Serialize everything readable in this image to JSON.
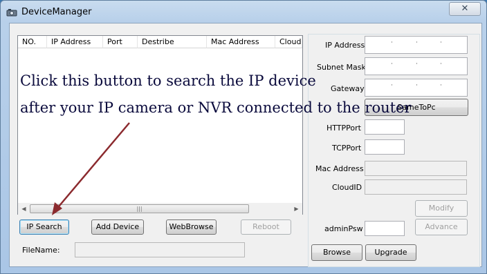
{
  "window": {
    "title": "DeviceManager",
    "close_label": "✕"
  },
  "device_list": {
    "columns": [
      "NO.",
      "IP Address",
      "Port",
      "Destribe",
      "Mac Address",
      "CloudID"
    ],
    "scroll_thumb_glyph": "|||",
    "scroll_left_glyph": "◀",
    "scroll_right_glyph": "▶"
  },
  "buttons": {
    "ip_search": "IP Search",
    "add_device": "Add Device",
    "web_browse": "WebBrowse",
    "reboot": "Reboot",
    "same_to_pc": "SameToPc",
    "modify": "Modify",
    "advance": "Advance",
    "browse": "Browse",
    "upgrade": "Upgrade"
  },
  "labels": {
    "file_name": "FileName:",
    "ip_address": "IP Address",
    "subnet_mask": "Subnet Mask",
    "gateway": "Gateway",
    "http_port": "HTTPPort",
    "tcp_port": "TCPPort",
    "mac_address": "Mac Address",
    "cloud_id": "CloudID",
    "admin_psw": "adminPsw"
  },
  "fields": {
    "file_name": "",
    "ip_address": "",
    "subnet_mask": "",
    "gateway": "",
    "http_port": "",
    "tcp_port": "",
    "mac_address": "",
    "cloud_id": "",
    "admin_psw": ""
  },
  "annotation": {
    "line1": "Click this button to search the IP device",
    "line2": "after your IP camera or NVR connected to  the router",
    "arrow_color": "#8b2a2e"
  },
  "colors": {
    "title_bar": "#b8d0ea",
    "client_bg": "#f0f0f0",
    "annotation_text": "#0a0a3c"
  }
}
